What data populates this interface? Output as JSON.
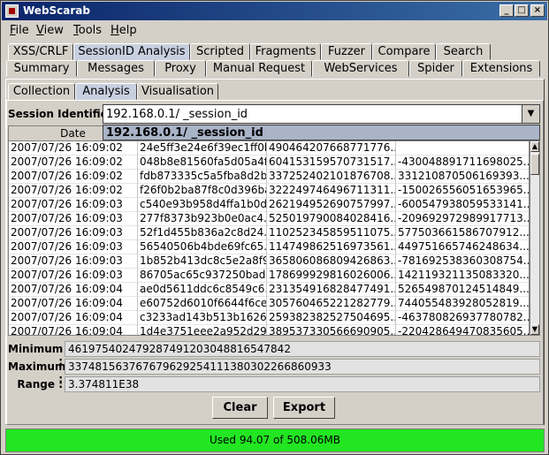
{
  "window": {
    "title": "WebScarab"
  },
  "menu": [
    {
      "label": "File",
      "mnemonic": "F",
      "rest": "ile"
    },
    {
      "label": "View",
      "mnemonic": "V",
      "rest": "iew"
    },
    {
      "label": "Tools",
      "mnemonic": "T",
      "rest": "ools"
    },
    {
      "label": "Help",
      "mnemonic": "H",
      "rest": "elp"
    }
  ],
  "tabs_row1": [
    "XSS/CRLF",
    "SessionID Analysis",
    "Scripted",
    "Fragments",
    "Fuzzer",
    "Compare",
    "Search"
  ],
  "tabs_row2": [
    "Summary",
    "Messages",
    "Proxy",
    "Manual Request",
    "WebServices",
    "Spider",
    "Extensions"
  ],
  "subtabs": [
    "Collection",
    "Analysis",
    "Visualisation"
  ],
  "session": {
    "label": "Session Identifier :",
    "value": "192.168.0.1/ _session_id",
    "dropdown_option": "192.168.0.1/ _session_id"
  },
  "table": {
    "columns": [
      "Date",
      "",
      "",
      ""
    ],
    "rows": [
      [
        "2007/07/26 16:09:02",
        "24e5ff3e24e6f39ec1ff0b...",
        "490464207668771776...",
        ""
      ],
      [
        "2007/07/26 16:09:02",
        "048b8e81560fa5d05a4f...",
        "604153159570731517...",
        "-430048891711698025..."
      ],
      [
        "2007/07/26 16:09:02",
        "fdb873335c5a5fba8d2b...",
        "337252402101876708...",
        "331210870506169393..."
      ],
      [
        "2007/07/26 16:09:02",
        "f26f0b2ba87f8c0d396ba...",
        "322249746496711311...",
        "-150026556051653965..."
      ],
      [
        "2007/07/26 16:09:03",
        "c540e93b958d4ffa1b0d...",
        "262194952690757997...",
        "-600547938059533141..."
      ],
      [
        "2007/07/26 16:09:03",
        "277f8373b923b0e0ac4...",
        "525019790084028416...",
        "-209692972989917713..."
      ],
      [
        "2007/07/26 16:09:03",
        "52f1d455b836a2c8d24...",
        "110252345859511075...",
        "577503661586707912..."
      ],
      [
        "2007/07/26 16:09:03",
        "56540506b4bde69fc65...",
        "114749862516973561...",
        "449751665746248634..."
      ],
      [
        "2007/07/26 16:09:03",
        "1b852b413dc8c5e2a8f9...",
        "365806086809426863...",
        "-781692538360308754..."
      ],
      [
        "2007/07/26 16:09:03",
        "86705ac65c937250bad...",
        "178699929816026006...",
        "142119321135083320..."
      ],
      [
        "2007/07/26 16:09:04",
        "ae0d5611ddc6c8549c6...",
        "231354916828477491...",
        "526549870124514849..."
      ],
      [
        "2007/07/26 16:09:04",
        "e60752d6010f6644f6ce...",
        "305760465221282779...",
        "744055483928052819..."
      ],
      [
        "2007/07/26 16:09:04",
        "c3233ad143b513b1626...",
        "259382382527504695...",
        "-463780826937780782..."
      ],
      [
        "2007/07/26 16:09:04",
        "1d4e3751eee2a952d29...",
        "389537330566690905...",
        "-220428649470835605..."
      ]
    ]
  },
  "stats": {
    "minimum_label": "Minimum :",
    "minimum_value": "461975402479287491203048816547842",
    "maximum_label": "Maximum :",
    "maximum_value": "3374815637676796292541113803022668609​33",
    "range_label": "Range :",
    "range_value": "3.374811E38"
  },
  "buttons": {
    "clear": "Clear",
    "export": "Export"
  },
  "status": {
    "text": "Used 94.07 of 508.06MB",
    "color": "#22e622"
  }
}
